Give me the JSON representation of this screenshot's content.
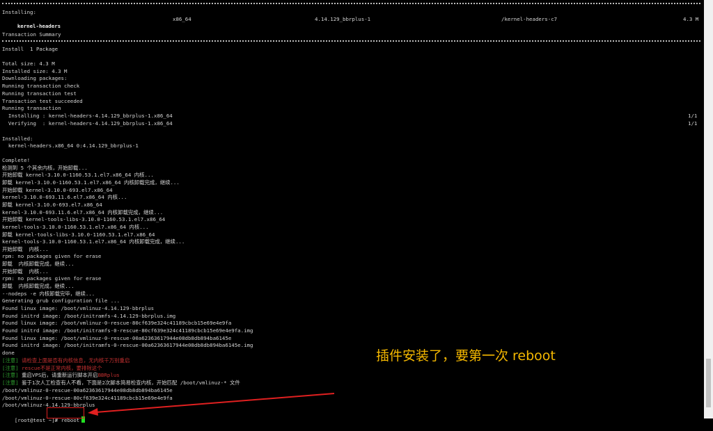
{
  "terminal": {
    "installing_label": "Installing:",
    "package": {
      "name": "kernel-headers",
      "arch": "x86_64",
      "version": "4.14.129_bbrplus-1",
      "repo": "/kernel-headers-c7",
      "size": "4.3 M"
    },
    "transaction_summary": "Transaction Summary",
    "install_line": "Install  1 Package",
    "lines_a": [
      "Total size: 4.3 M",
      "Installed size: 4.3 M",
      "Downloading packages:",
      "Running transaction check",
      "Running transaction test",
      "Transaction test succeeded",
      "Running transaction"
    ],
    "progress": [
      {
        "text": "  Installing : kernel-headers-4.14.129_bbrplus-1.x86_64",
        "count": "1/1"
      },
      {
        "text": "  Verifying  : kernel-headers-4.14.129_bbrplus-1.x86_64",
        "count": "1/1"
      }
    ],
    "installed_label": "Installed:",
    "installed_pkg": "  kernel-headers.x86_64 0:4.14.129_bbrplus-1",
    "lines_b": [
      "Complete!",
      "检测到 5 个其余内核，开始卸载...",
      "开始卸载 kernel-3.10.0-1160.53.1.el7.x86_64 内核...",
      "卸载 kernel-3.10.0-1160.53.1.el7.x86_64 内核卸载完成，继续...",
      "开始卸载 kernel-3.10.0-693.el7.x86_64",
      "kernel-3.10.0-693.11.6.el7.x86_64 内核...",
      "卸载 kernel-3.10.0-693.el7.x86_64",
      "kernel-3.10.0-693.11.6.el7.x86_64 内核卸载完成，继续...",
      "开始卸载 kernel-tools-libs-3.10.0-1160.53.1.el7.x86_64",
      "kernel-tools-3.10.0-1160.53.1.el7.x86_64 内核...",
      "卸载 kernel-tools-libs-3.10.0-1160.53.1.el7.x86_64",
      "kernel-tools-3.10.0-1160.53.1.el7.x86_64 内核卸载完成，继续...",
      "开始卸载  内核...",
      "rpm: no packages given for erase",
      "卸载  内核卸载完成，继续...",
      "开始卸载  内核...",
      "rpm: no packages given for erase",
      "卸载  内核卸载完成，继续...",
      "--nodeps -e 内核卸载完毕，继续...",
      "Generating grub configuration file ...",
      "Found linux image: /boot/vmlinuz-4.14.129-bbrplus",
      "Found initrd image: /boot/initramfs-4.14.129-bbrplus.img",
      "Found linux image: /boot/vmlinuz-0-rescue-80cf639e324c41189cbcb15e69e4e9fa",
      "Found initrd image: /boot/initramfs-0-rescue-80cf639e324c41189cbcb15e69e4e9fa.img",
      "Found linux image: /boot/vmlinuz-0-rescue-00a62363617944e08db8db894ba6145e",
      "Found initrd image: /boot/initramfs-0-rescue-00a62363617944e08db8db894ba6145e.img",
      "done"
    ],
    "notes": [
      {
        "tag": "[注意]",
        "text": " 请检查上面是否有内核信息，无内核千万别重启",
        "style": "red"
      },
      {
        "tag": "[注意]",
        "text": " rescue不是正常内核，要排除这个",
        "style": "red"
      },
      {
        "tag": "[注意]",
        "text": " 重启VPS后，请重新运行脚本开启",
        "text2": "BBRplus",
        "style": "mixed"
      },
      {
        "tag": "[注意]",
        "text": " 鉴于1次人工检查有人不看，下面是2次脚本简易检查内核，开始匹配 /boot/vmlinuz-* 文件",
        "style": "plain"
      }
    ],
    "lines_c": [
      "/boot/vmlinuz-0-rescue-00a62363617944e08db8db894ba6145e",
      "/boot/vmlinuz-0-rescue-80cf639e324c41189cbcb15e69e4e9fa",
      "/boot/vmlinuz-4.14.129-bbrplus"
    ],
    "prompt": "[root@test ~]# ",
    "command": "reboot"
  },
  "annotation": "插件安装了，要第一次  reboot",
  "colors": {
    "background": "#000000",
    "text": "#d4d4d4",
    "note_tag": "#2e9e2e",
    "note_red": "#c43030",
    "annotation": "#f5b800",
    "highlight_box": "#e02020",
    "cursor": "#22e022"
  }
}
